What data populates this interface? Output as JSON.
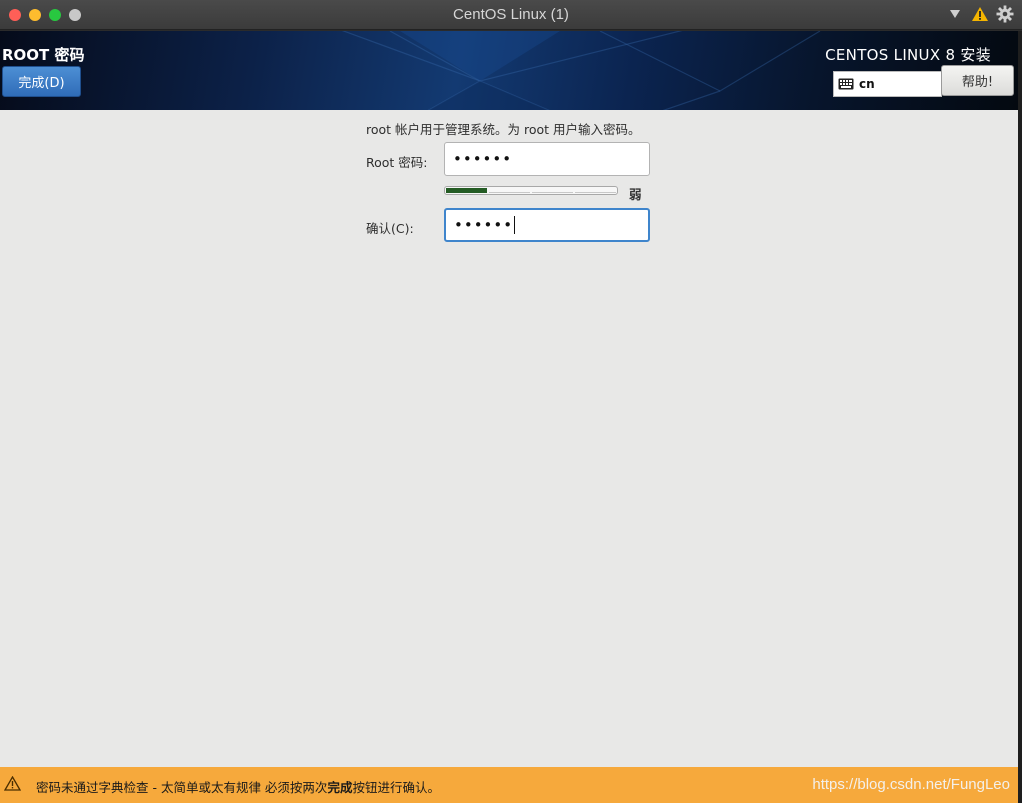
{
  "window": {
    "title": "CentOS Linux (1)",
    "controls": [
      "close",
      "minimize",
      "maximize",
      "extra"
    ],
    "tray_icons": [
      "chevron-down-icon",
      "warning-icon",
      "gear-icon"
    ]
  },
  "header": {
    "spoke_title": "ROOT 密码",
    "done_label": "完成(D)",
    "product_title": "CENTOS LINUX 8 安装",
    "keyboard_layout": "cn",
    "help_label": "帮助!"
  },
  "form": {
    "description": "root 帐户用于管理系统。为 root 用户输入密码。",
    "root_label": "Root 密码:",
    "root_value": "••••••",
    "strength_label": "弱",
    "strength_level": 0.25,
    "confirm_label": "确认(C):",
    "confirm_value": "••••••"
  },
  "warning": {
    "text_prefix": "密码未通过字典检查 - 太简单或太有规律 必须按两次",
    "text_bold": "完成",
    "text_suffix": "按钮进行确认。",
    "color": "#f6a93c"
  },
  "watermark": "https://blog.csdn.net/FungLeo"
}
